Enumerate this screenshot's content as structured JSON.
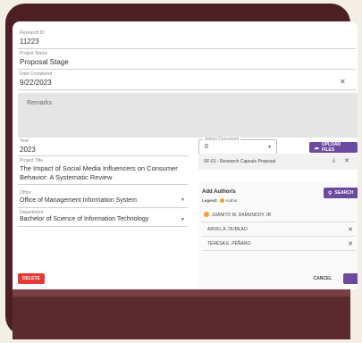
{
  "research_id": {
    "label": "Research ID",
    "value": "11223"
  },
  "project_status": {
    "label": "Project Status",
    "value": "Proposal Stage"
  },
  "date_completed": {
    "label": "Date Completed",
    "value": "9/22/2023"
  },
  "remarks_placeholder": "Remarks",
  "year": {
    "label": "Year",
    "value": "2023"
  },
  "project_title": {
    "label": "Project Title",
    "value_line1": "The Impact of Social Media Influencers on Consumer",
    "value_line2": "Behavior: A Systematic Review"
  },
  "office": {
    "label": "Office",
    "value": "Office of Management Information System"
  },
  "department": {
    "label": "Department",
    "value": "Bachelor of Science of Information Technology"
  },
  "document": {
    "select_label": "Select Document",
    "select_value": "0",
    "upload_label": "UPLOAD FILES",
    "file_name": "SF-01 - Research Capsule Proposal"
  },
  "authors": {
    "title": "Add Author/s",
    "legend_label": "Legend:",
    "legend_item": "Author",
    "search_label": "SEARCH",
    "list": [
      "JUANITO M. DAMUNDOY JR",
      "ARVEL A. DUMLAO",
      "TERESA E. PEÑANO"
    ]
  },
  "actions": {
    "delete": "DELETE",
    "cancel": "CANCEL"
  },
  "colors": {
    "accent": "#6b4aa0",
    "danger": "#e53935",
    "frame": "#4b1f24",
    "author_badge": "#f0a030"
  }
}
